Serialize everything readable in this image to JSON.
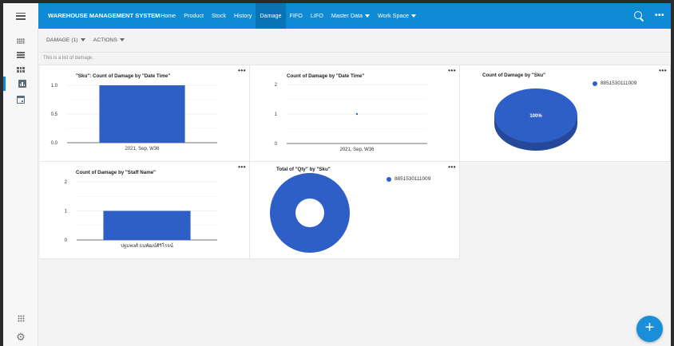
{
  "header": {
    "app_title": "WAREHOUSE MANAGEMENT SYSTEM",
    "nav": [
      {
        "label": "Home"
      },
      {
        "label": "Product"
      },
      {
        "label": "Stock"
      },
      {
        "label": "History"
      },
      {
        "label": "Damage",
        "active": true
      },
      {
        "label": "FIFO"
      },
      {
        "label": "LIFO"
      },
      {
        "label": "Master Data",
        "dropdown": true
      },
      {
        "label": "Work Space",
        "dropdown": true
      }
    ]
  },
  "toolbar": {
    "view_select": "DAMAGE (1)",
    "actions": "ACTIONS"
  },
  "description": "This is a list of damage.",
  "colors": {
    "accent": "#0f8bd6",
    "series": "#2e5fc6",
    "series_dark": "#25489b"
  },
  "charts": {
    "c1": {
      "title": "\"Sku\": Count of Damage by \"Date Time\"",
      "menu": "•••"
    },
    "c2": {
      "title": "Count of Damage by \"Date Time\"",
      "menu": "•••"
    },
    "c3": {
      "title": "Count of Damage by \"Sku\"",
      "menu": "•••",
      "legend": "8851530111009",
      "slice_label": "100%"
    },
    "c4": {
      "title": "Count of Damage by \"Staff Name\"",
      "menu": "•••"
    },
    "c5": {
      "title": "Total of \"Qty\" by \"Sku\"",
      "menu": "•••",
      "legend": "8851530111009"
    }
  },
  "chart_data": [
    {
      "type": "bar",
      "title": "\"Sku\": Count of Damage by \"Date Time\"",
      "categories": [
        "2021, Sep, W36"
      ],
      "values": [
        1
      ],
      "ylim": [
        0,
        1
      ],
      "yticks": [
        "1.0",
        "0.5",
        "0.0"
      ]
    },
    {
      "type": "line",
      "title": "Count of Damage by \"Date Time\"",
      "categories": [
        "2021, Sep, W36"
      ],
      "values": [
        1
      ],
      "ylim": [
        0,
        2
      ],
      "yticks": [
        "2",
        "1",
        "0"
      ]
    },
    {
      "type": "pie",
      "title": "Count of Damage by \"Sku\"",
      "categories": [
        "8851530111009"
      ],
      "values": [
        100
      ],
      "labels": [
        "100%"
      ]
    },
    {
      "type": "bar",
      "title": "Count of Damage by \"Staff Name\"",
      "categories": [
        "ปฐมพงศ์ ธนพัฒน์ศิริโรจน์"
      ],
      "values": [
        1
      ],
      "ylim": [
        0,
        2
      ],
      "yticks": [
        "2",
        "1",
        "0"
      ]
    },
    {
      "type": "pie",
      "title": "Total of \"Qty\" by \"Sku\"",
      "categories": [
        "8851530111009"
      ],
      "values": [
        1
      ],
      "donut": true
    }
  ],
  "fab_label": "+"
}
